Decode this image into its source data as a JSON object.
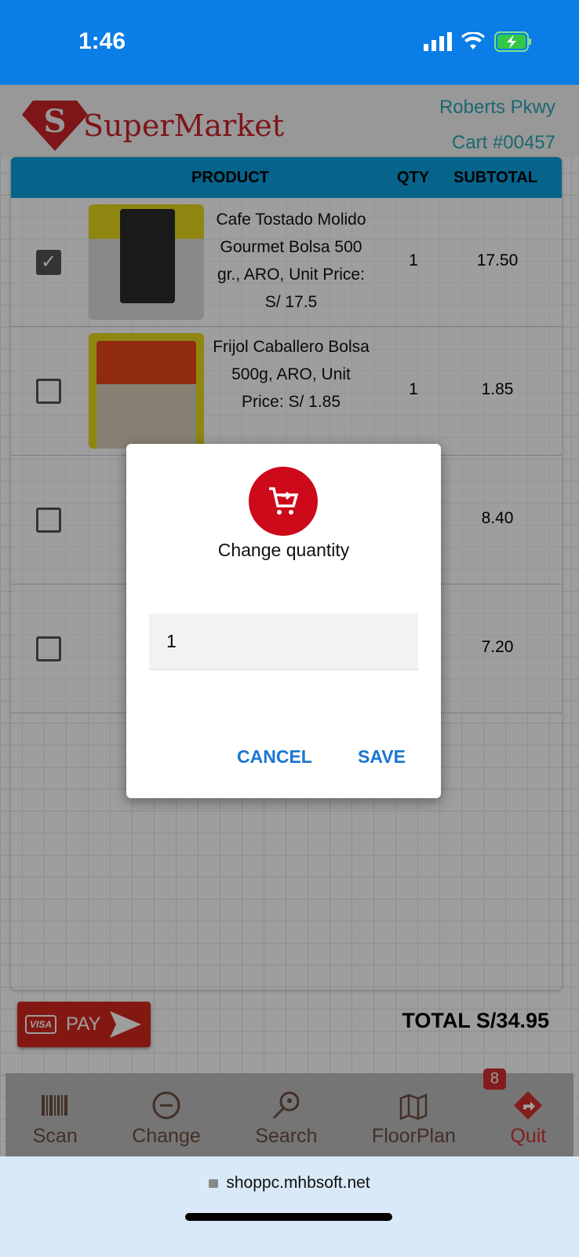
{
  "status_bar": {
    "time": "1:46"
  },
  "header": {
    "brand": "SuperMarket",
    "store": "Roberts Pkwy",
    "cart": "Cart #00457"
  },
  "table": {
    "columns": [
      "PRODUCT",
      "QTY",
      "SUBTOTAL"
    ],
    "rows": [
      {
        "checked": true,
        "name": "Cafe Tostado Molido Gourmet Bolsa 500 gr., ARO, Unit Price: S/ 17.5",
        "qty": "1",
        "subtotal": "17.50"
      },
      {
        "checked": false,
        "name": "Frijol Caballero Bolsa 500g, ARO, Unit Price: S/ 1.85",
        "qty": "1",
        "subtotal": "1.85"
      },
      {
        "checked": false,
        "name": "",
        "qty": "",
        "subtotal": "8.40"
      },
      {
        "checked": false,
        "name": "",
        "qty": "",
        "subtotal": "7.20"
      }
    ]
  },
  "pay": {
    "card": "VISA",
    "label": "PAY"
  },
  "total": "TOTAL S/34.95",
  "nav": {
    "items": [
      {
        "label": "Scan",
        "icon": "barcode-icon"
      },
      {
        "label": "Change",
        "icon": "minus-circle-icon"
      },
      {
        "label": "Search",
        "icon": "search-location-icon"
      },
      {
        "label": "FloorPlan",
        "icon": "map-icon",
        "badge": "8"
      },
      {
        "label": "Quit",
        "icon": "exit-diamond-icon"
      }
    ]
  },
  "dialog": {
    "title": "Change quantity",
    "value": "1",
    "cancel": "CANCEL",
    "save": "SAVE",
    "icon": "cart-arrow-icon"
  },
  "browser": {
    "url": "shoppc.mhbsoft.net"
  },
  "colors": {
    "accent": "#1976d2",
    "brand": "#cc2229",
    "table_header": "#0aa0df",
    "status_bar": "#0a7ee6"
  }
}
